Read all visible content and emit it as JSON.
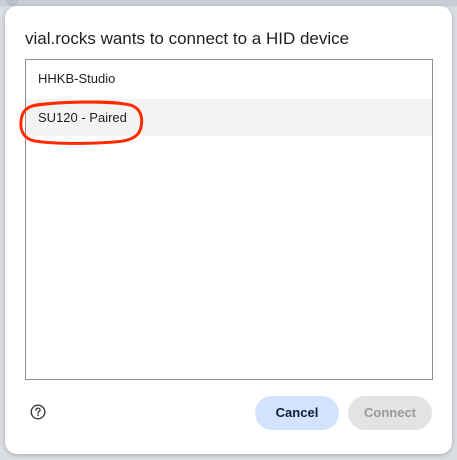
{
  "dialog": {
    "title": "vial.rocks wants to connect to a HID device",
    "devices": [
      {
        "label": "HHKB-Studio"
      },
      {
        "label": "SU120 - Paired"
      }
    ],
    "help_icon": "help-circle-icon",
    "cancel_label": "Cancel",
    "connect_label": "Connect",
    "connect_enabled": false
  },
  "annotation": {
    "highlight_color": "#ff2a00",
    "highlighted_device_index": 1
  },
  "colors": {
    "cancel_bg": "#d3e3fd",
    "connect_disabled_bg": "#e3e3e3",
    "selected_row_bg": "#f3f3f1"
  }
}
